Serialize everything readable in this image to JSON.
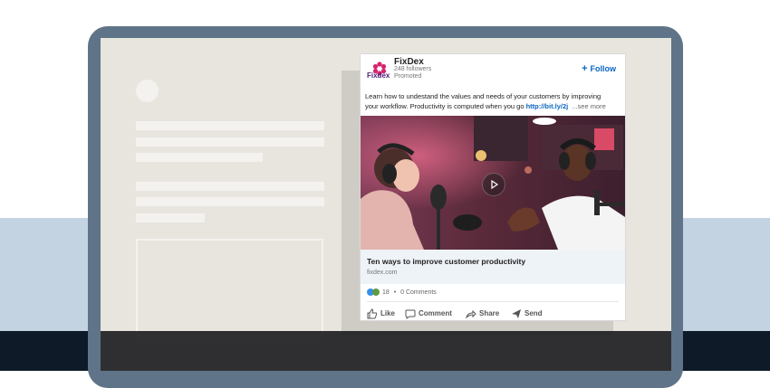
{
  "ad": {
    "company": "FixDex",
    "logo_text": "Fixdex",
    "followers": "248 followers",
    "promoted": "Promoted",
    "follow_label": "Follow",
    "body_line1": "Learn how to undestand the values and needs of your customers by improving",
    "body_line2": "your workflow. Productivity is computed when you go",
    "link": "http://bit.ly/2j",
    "see_more": "...see more",
    "headline": "Ten ways to improve customer productivity",
    "domain": "fixdex.com",
    "reaction_count": "18",
    "bullet": "•",
    "comments": "0 Comments",
    "actions": {
      "like": "Like",
      "comment": "Comment",
      "share": "Share",
      "send": "Send"
    }
  },
  "colors": {
    "brand_link": "#0a66c2",
    "band": "#c3d3e2",
    "laptop_frame": "#5f7488"
  }
}
